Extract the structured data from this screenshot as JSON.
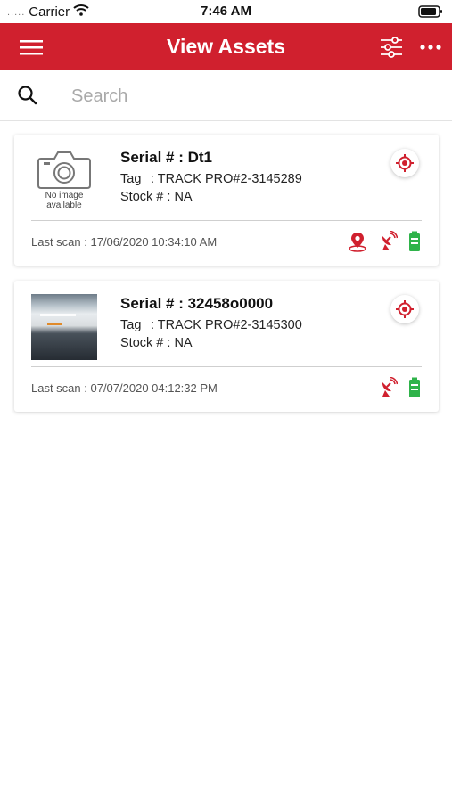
{
  "status_bar": {
    "carrier": "Carrier",
    "time": "7:46 AM",
    "signal_dots": "....."
  },
  "header": {
    "title": "View Assets",
    "menu_icon": "hamburger-icon",
    "filter_icon": "sliders-icon",
    "more_icon": "more-horizontal-icon",
    "color": "#d0202e"
  },
  "search": {
    "placeholder": "Search",
    "value": ""
  },
  "assets": [
    {
      "serial": "Serial # : Dt1",
      "tag_label": "Tag",
      "tag_value": ": TRACK PRO#2-3145289",
      "stock": "Stock # : NA",
      "last_scan": "Last scan : 17/06/2020 10:34:10 AM",
      "image_placeholder": "No image available",
      "status_icons": [
        "map-pin-icon",
        "satellite-icon",
        "battery-icon"
      ]
    },
    {
      "serial": "Serial # : 32458o0000",
      "tag_label": "Tag",
      "tag_value": ": TRACK PRO#2-3145300",
      "stock": "Stock # : NA",
      "last_scan": "Last scan : 07/07/2020 04:12:32 PM",
      "status_icons": [
        "satellite-icon",
        "battery-icon"
      ]
    }
  ],
  "colors": {
    "accent": "#d0202e",
    "battery": "#2fb34a"
  }
}
